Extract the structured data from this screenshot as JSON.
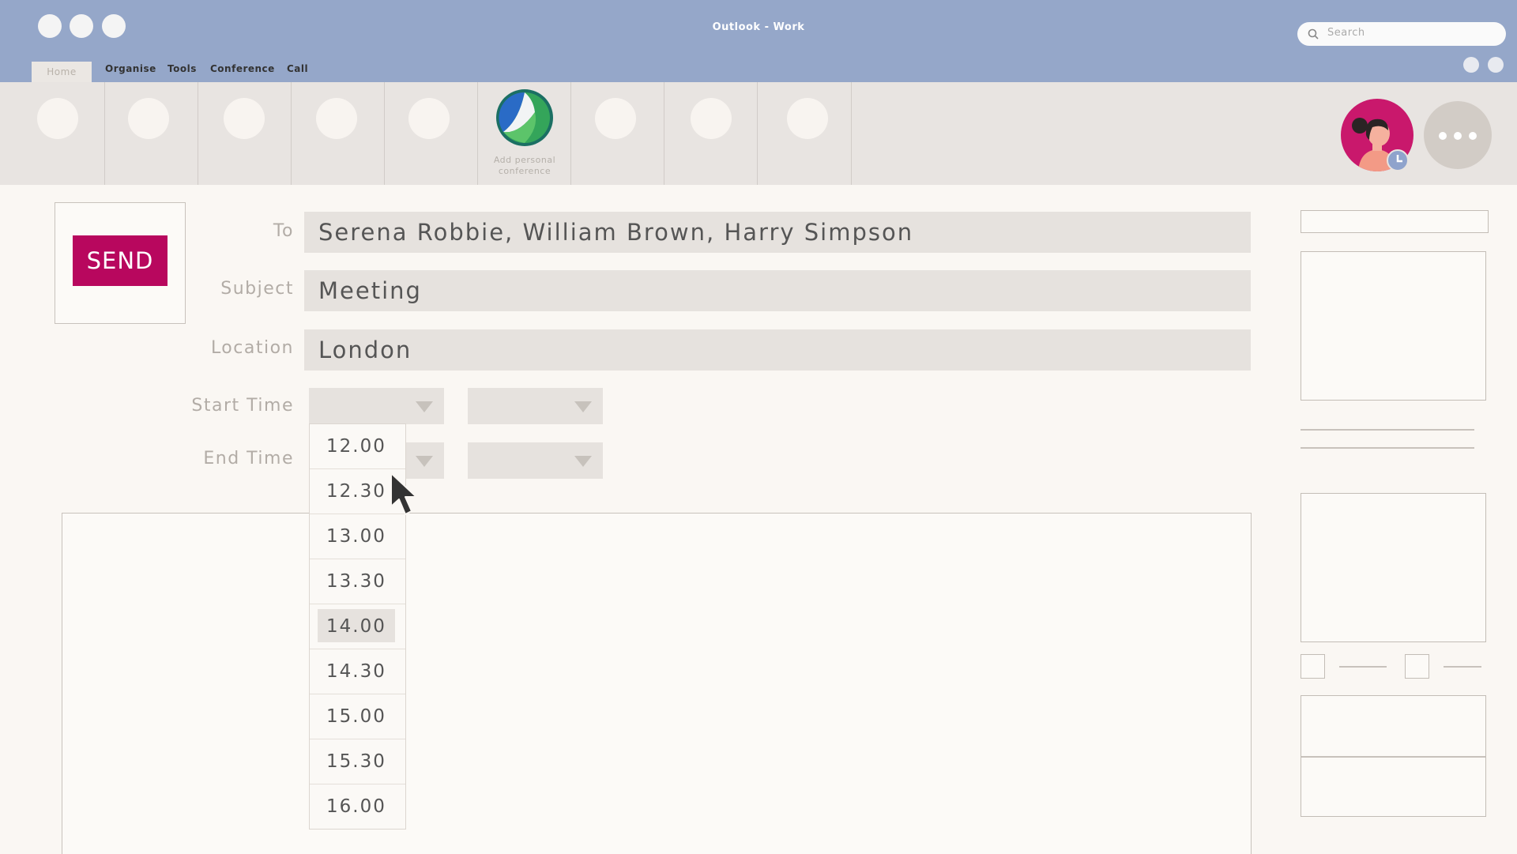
{
  "window": {
    "title": "Outlook - Work"
  },
  "search": {
    "placeholder": "Search"
  },
  "menu": {
    "tabs": [
      "Home",
      "Organise",
      "Tools",
      "Conference",
      "Call"
    ],
    "active": "Home"
  },
  "ribbon": {
    "conference_label": "Add personal conference"
  },
  "compose": {
    "send_label": "SEND",
    "to_label": "To",
    "to_value": "Serena Robbie, William Brown, Harry Simpson",
    "subject_label": "Subject",
    "subject_value": "Meeting",
    "location_label": "Location",
    "location_value": "London",
    "start_label": "Start Time",
    "end_label": "End Time"
  },
  "time_dropdown": {
    "options": [
      "12.00",
      "12.30",
      "13.00",
      "13.30",
      "14.00",
      "14.30",
      "15.00",
      "15.30",
      "16.00"
    ],
    "highlighted": "14.00"
  },
  "colors": {
    "titlebar": "#95a7c9",
    "send": "#b8075e",
    "ribbon": "#e8e4e1"
  }
}
